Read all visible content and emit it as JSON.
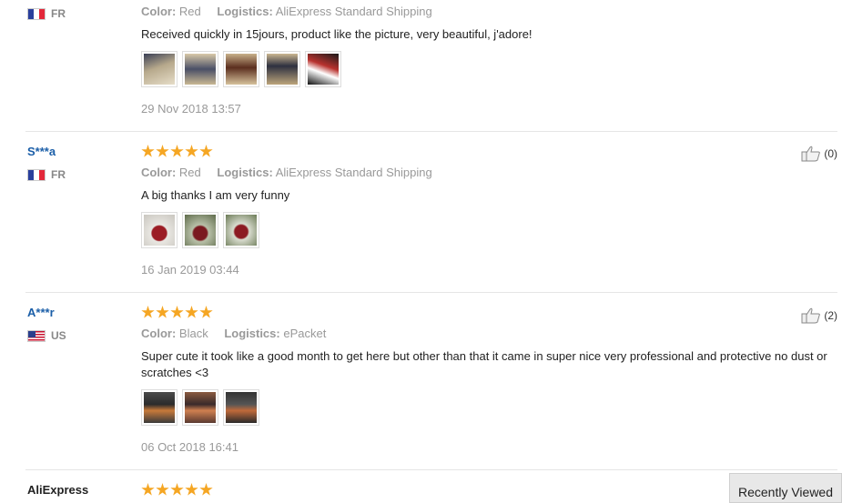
{
  "reviews": [
    {
      "country": "FR",
      "color_key": "Color:",
      "color_value": "Red",
      "logistics_key": "Logistics:",
      "logistics_value": "AliExpress Standard Shipping",
      "text": "Received quickly in 15jours, product like the picture, very beautiful, j'adore!",
      "date": "29 Nov 2018 13:57"
    },
    {
      "user": "S***a",
      "country": "FR",
      "rating": 5,
      "color_key": "Color:",
      "color_value": "Red",
      "logistics_key": "Logistics:",
      "logistics_value": "AliExpress Standard Shipping",
      "text": "A big thanks I am very funny",
      "date": "16 Jan 2019 03:44",
      "helpful": "(0)"
    },
    {
      "user": "A***r",
      "country": "US",
      "rating": 5,
      "color_key": "Color:",
      "color_value": "Black",
      "logistics_key": "Logistics:",
      "logistics_value": "ePacket",
      "text": "Super cute it took like a good month to get here but other than that it came in super nice very professional and protective no dust or scratches <3",
      "date": "06 Oct 2018 16:41",
      "helpful": "(2)"
    },
    {
      "user": "AliExpress",
      "rating": 5
    }
  ],
  "recently_viewed": "Recently Viewed",
  "colors": {
    "star": "#f5a623",
    "username": "#1a5ea8"
  },
  "icons": {
    "helpful": "thumbs-up-icon"
  }
}
